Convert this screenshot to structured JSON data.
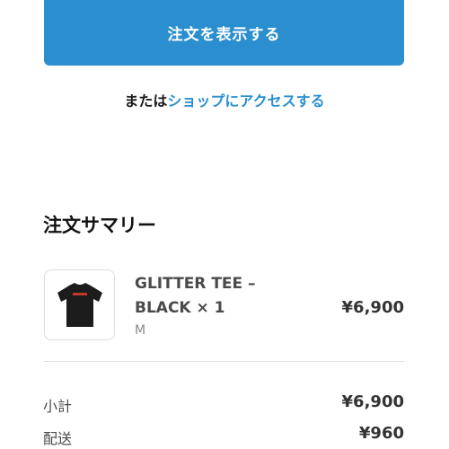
{
  "cta": {
    "label": "注文を表示する"
  },
  "shop_prompt": {
    "prefix": "または",
    "link": "ショップにアクセスする"
  },
  "summary": {
    "title": "注文サマリー",
    "item": {
      "name": "GLITTER TEE – BLACK × 1",
      "variant": "M",
      "price": "¥6,900",
      "image_icon": "black-tshirt-icon"
    },
    "subtotal": {
      "label": "小計",
      "value": "¥6,900"
    },
    "shipping": {
      "label": "配送",
      "value": "¥960"
    }
  },
  "colors": {
    "accent": "#2b8fcf",
    "tee": "#1c1c1c",
    "tee_print": "#c0392b"
  }
}
